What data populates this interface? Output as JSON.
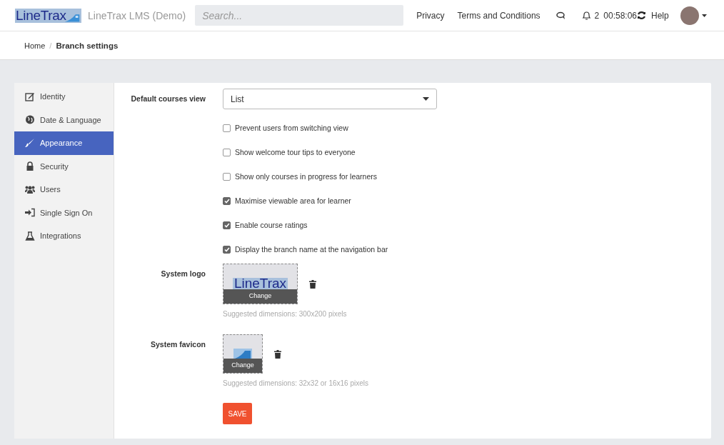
{
  "header": {
    "logo": "LineTrax",
    "site_name": "LineTrax LMS (Demo)",
    "search": {
      "placeholder": "Search..."
    },
    "links": [
      "Privacy",
      "Terms and Conditions"
    ],
    "notification_count": "2",
    "timer": "00:58:06",
    "help": "Help"
  },
  "breadcrumb": [
    "Home",
    "/",
    "Branch settings"
  ],
  "sidebar": {
    "items": [
      {
        "label": "Identity",
        "selected": false
      },
      {
        "label": "Date & Language",
        "selected": false
      },
      {
        "label": "Appearance",
        "selected": true
      },
      {
        "label": "Security",
        "selected": false
      },
      {
        "label": "Users",
        "selected": false
      },
      {
        "label": "Single Sign On",
        "selected": false
      },
      {
        "label": "Integrations",
        "selected": false
      }
    ]
  },
  "form": {
    "default_view": {
      "label": "Default courses view",
      "value": "List"
    },
    "options": [
      {
        "label": "Prevent users from switching view",
        "checked": false
      },
      {
        "label": "Show welcome tour tips to everyone",
        "checked": false
      },
      {
        "label": "Show only courses in progress for learners",
        "checked": false
      },
      {
        "label": "Maximise viewable area for learner",
        "checked": true
      },
      {
        "label": "Enable course ratings",
        "checked": true
      },
      {
        "label": "Display the branch name at the navigation bar",
        "checked": true
      }
    ],
    "uploads": [
      {
        "kind": "logo",
        "label": "System logo",
        "logo_text": "LineTrax",
        "button": "Change",
        "hint": "Suggested dimensions: 300x200 pixels"
      },
      {
        "kind": "favicon",
        "label": "System favicon",
        "button": "Change",
        "hint": "Suggested dimensions: 32x32 or 16x16 pixels"
      }
    ],
    "save": "SAVE"
  }
}
